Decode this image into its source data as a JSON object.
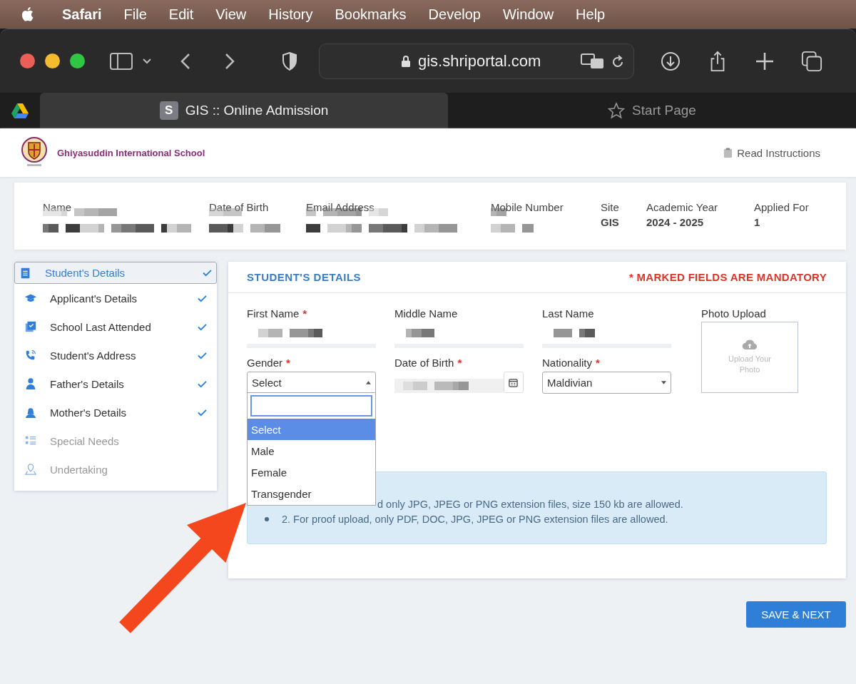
{
  "menu_bar": {
    "app": "Safari",
    "items": [
      "File",
      "Edit",
      "View",
      "History",
      "Bookmarks",
      "Develop",
      "Window",
      "Help"
    ]
  },
  "toolbar": {
    "address": "gis.shriportal.com"
  },
  "tabs": [
    {
      "label": "GIS :: Online Admission",
      "favicon": "S",
      "selected": true
    },
    {
      "label": "Start Page",
      "selected": false
    }
  ],
  "header": {
    "school": "Ghiyasuddin International School",
    "link": "Read Instructions"
  },
  "summary": [
    {
      "label": "Name"
    },
    {
      "label": "Date of Birth"
    },
    {
      "label": "Email Address"
    },
    {
      "label": "Mobile Number"
    },
    {
      "label": "Site",
      "value": "GIS"
    },
    {
      "label": "Academic Year",
      "value": "2024 - 2025"
    },
    {
      "label": "Applied For",
      "value": "1"
    }
  ],
  "sidebar": [
    {
      "label": "Student's Details",
      "selected": true,
      "done": true,
      "disabled": false
    },
    {
      "label": "Applicant's Details",
      "selected": false,
      "done": true,
      "disabled": false
    },
    {
      "label": "School Last Attended",
      "selected": false,
      "done": true,
      "disabled": false
    },
    {
      "label": "Student's Address",
      "selected": false,
      "done": true,
      "disabled": false
    },
    {
      "label": "Father's Details",
      "selected": false,
      "done": true,
      "disabled": false
    },
    {
      "label": "Mother's Details",
      "selected": false,
      "done": true,
      "disabled": false
    },
    {
      "label": "Special Needs",
      "selected": false,
      "done": false,
      "disabled": true
    },
    {
      "label": "Undertaking",
      "selected": false,
      "done": false,
      "disabled": true
    }
  ],
  "panel": {
    "title": "STUDENT'S DETAILS",
    "mandatory": "* MARKED FIELDS ARE MANDATORY",
    "fields": [
      {
        "label": "First Name",
        "mark": "*",
        "kind": "text"
      },
      {
        "label": "Middle Name",
        "kind": "text"
      },
      {
        "label": "Last Name",
        "kind": "text"
      },
      {
        "label": "Gender",
        "mark": "*",
        "kind": "select",
        "value": "Select",
        "expanded": true
      },
      {
        "label": "Date of Birth",
        "mark": "*",
        "kind": "date"
      },
      {
        "label": "Nationality",
        "mark": "*",
        "kind": "select",
        "value": "Maldivian",
        "expanded": false
      }
    ],
    "photo": {
      "label": "Photo Upload",
      "hint": "Upload Your Photo"
    },
    "dropdown": [
      {
        "label": "Select",
        "selected": true
      },
      {
        "label": "Male",
        "selected": false
      },
      {
        "label": "Female",
        "selected": false
      },
      {
        "label": "Transgender",
        "selected": false
      }
    ],
    "notes": [
      {
        "text": "d only JPG, JPEG or PNG extension files, size 150 kb are allowed.",
        "bullet": false
      },
      {
        "text": "2. For proof upload, only PDF, DOC, JPG, JPEG or PNG extension files are allowed.",
        "bullet": true
      }
    ]
  },
  "save_button": "SAVE & NEXT"
}
